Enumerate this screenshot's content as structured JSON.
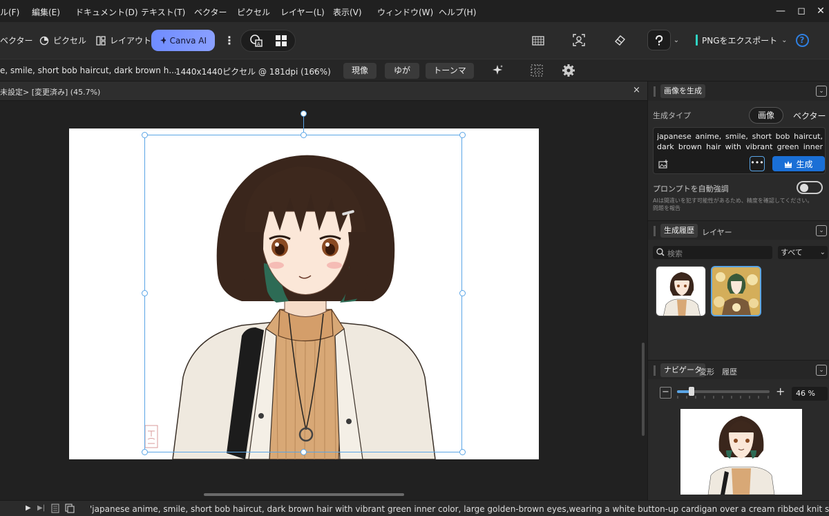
{
  "menu": [
    "ル(F)",
    "編集(E)",
    "ドキュメント(D)",
    "テキスト(T)",
    "ベクター",
    "ピクセル",
    "レイヤー(L)",
    "表示(V)",
    "ウィンドウ(W)",
    "ヘルプ(H)"
  ],
  "window_controls": {
    "minimize": "—",
    "maximize": "◻",
    "close": "✕"
  },
  "toolbar": {
    "persona_vector": "ベクター",
    "persona_pixel": "ピクセル",
    "persona_layout": "レイアウト",
    "canva_ai": "Canva AI",
    "export_label": "PNGをエクスポート",
    "help_label": "?"
  },
  "context": {
    "doc_name": "e, smile, short bob haircut, dark brown h...",
    "doc_size": "1440x1440ピクセル @ 181dpi (166%)",
    "develop": "現像",
    "distort": "ゆがみ",
    "tonemap": "トーンマップ"
  },
  "doctab": {
    "title": "未設定> [変更済み] (45.7%)",
    "close": "×"
  },
  "panel_generate": {
    "tab": "画像を生成",
    "gen_type_label": "生成タイプ",
    "type_image": "画像",
    "type_vector": "ベクター",
    "prompt": "japanese anime, smile, short bob haircut, dark brown hair with vibrant green inner color, large",
    "generate_button": "生成",
    "more": "•••",
    "auto_enhance_label": "プロンプトを自動強調",
    "notice": "AIは間違いを犯す可能性があるため、精度を確認してください。",
    "report": "問題を報告"
  },
  "panel_history": {
    "tab_history": "生成履歴",
    "tab_layers": "レイヤー",
    "search_placeholder": "検索",
    "filter": "すべて"
  },
  "panel_navigator": {
    "tab_navigator": "ナビゲータ",
    "tab_transform": "変形",
    "tab_history": "履歴",
    "zoom_value": "46 %",
    "zoom_fraction": 0.16
  },
  "status": {
    "text": "'japanese anime, smile, short bob haircut, dark brown hair with vibrant green inner color, large golden-brown eyes,wearing a white button-up cardigan over a cream ribbed knit sweater, layered cloth"
  },
  "colors": {
    "accent": "#5aa5e6",
    "canva": "#7b8fff",
    "generate": "#1a6fd6"
  }
}
